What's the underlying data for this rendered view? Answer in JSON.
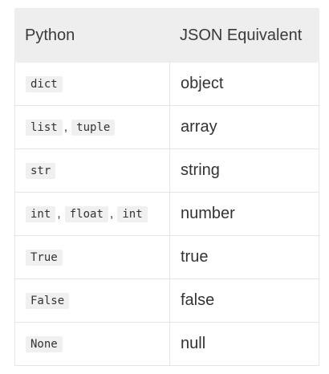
{
  "table": {
    "header": {
      "python": "Python",
      "json": "JSON Equivalent"
    },
    "rows": [
      {
        "python": [
          "dict"
        ],
        "json": "object"
      },
      {
        "python": [
          "list",
          "tuple"
        ],
        "json": "array"
      },
      {
        "python": [
          "str"
        ],
        "json": "string"
      },
      {
        "python": [
          "int",
          "float",
          "int"
        ],
        "json": "number"
      },
      {
        "python": [
          "True"
        ],
        "json": "true"
      },
      {
        "python": [
          "False"
        ],
        "json": "false"
      },
      {
        "python": [
          "None"
        ],
        "json": "null"
      }
    ],
    "separator": ","
  }
}
